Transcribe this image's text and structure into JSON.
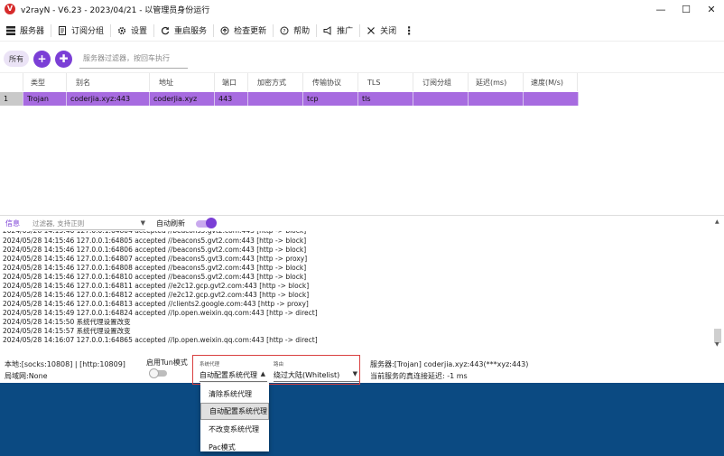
{
  "window": {
    "title": "v2rayN - V6.23 - 2023/04/21 - 以管理员身份运行",
    "minimize_glyph": "—",
    "maximize_glyph": "☐",
    "close_glyph": "✕"
  },
  "toolbar": {
    "servers": "服务器",
    "subscription": "订阅分组",
    "settings": "设置",
    "restart": "重启服务",
    "check_update": "检查更新",
    "help": "帮助",
    "promote": "推广",
    "close": "关闭"
  },
  "filter": {
    "all": "所有",
    "placeholder": "服务器过滤器，按回车执行"
  },
  "grid": {
    "columns": [
      "类型",
      "别名",
      "地址",
      "端口",
      "加密方式",
      "传输协议",
      "TLS",
      "订阅分组",
      "延迟(ms)",
      "速度(M/s)"
    ],
    "rows": [
      {
        "index": "1",
        "type": "Trojan",
        "alias": "coderjia.xyz:443",
        "address": "coderjia.xyz",
        "port": "443",
        "security": "",
        "network": "tcp",
        "tls": "tls",
        "subid": "",
        "delay": "",
        "speed": ""
      }
    ]
  },
  "log": {
    "tab": "信息",
    "filter_placeholder": "过滤器, 支持正则",
    "auto_refresh": "自动刷新",
    "auto_refresh_on": true,
    "lines": [
      "2024/05/28 14:15:46 127.0.0.1:64805 accepted //beacons5.gvt2.com:443 [http -> block]",
      "2024/05/28 14:15:46 127.0.0.1:64806 accepted //beacons5.gvt2.com:443 [http -> block]",
      "2024/05/28 14:15:46 127.0.0.1:64807 accepted //beacons5.gvt3.com:443 [http -> proxy]",
      "2024/05/28 14:15:46 127.0.0.1:64808 accepted //beacons5.gvt2.com:443 [http -> block]",
      "2024/05/28 14:15:46 127.0.0.1:64810 accepted //beacons5.gvt2.com:443 [http -> block]",
      "2024/05/28 14:15:46 127.0.0.1:64811 accepted //e2c12.gcp.gvt2.com:443 [http -> block]",
      "2024/05/28 14:15:46 127.0.0.1:64812 accepted //e2c12.gcp.gvt2.com:443 [http -> block]",
      "2024/05/28 14:15:46 127.0.0.1:64813 accepted //clients2.google.com:443 [http -> proxy]",
      "2024/05/28 14:15:49 127.0.0.1:64824 accepted //lp.open.weixin.qq.com:443 [http -> direct]",
      "2024/05/28 14:15:50 系统代理设置改变",
      "2024/05/28 14:15:57 系统代理设置改变",
      "2024/05/28 14:16:07 127.0.0.1:64865 accepted //lp.open.weixin.qq.com:443 [http -> direct]"
    ]
  },
  "status": {
    "local": "本地:[socks:10808] | [http:10809]",
    "lan": "局域网:None",
    "tun_label": "启用Tun模式",
    "tun_on": false,
    "sysproxy_caption": "系统代理",
    "sysproxy_value": "自动配置系统代理",
    "routing_caption": "路由",
    "routing_value": "绕过大陆(Whitelist)",
    "server": "服务器:[Trojan] coderjia.xyz:443(***xyz:443)",
    "delay": "当前服务的真连接延迟: -1 ms"
  },
  "dropdown": {
    "options": [
      "清除系统代理",
      "自动配置系统代理",
      "不改变系统代理",
      "Pac模式"
    ],
    "selected_index": 1
  },
  "colors": {
    "accent": "#7b3fd6",
    "selected_row": "#a76be0",
    "highlight_box": "#d94040",
    "desktop": "#0b4a82"
  }
}
